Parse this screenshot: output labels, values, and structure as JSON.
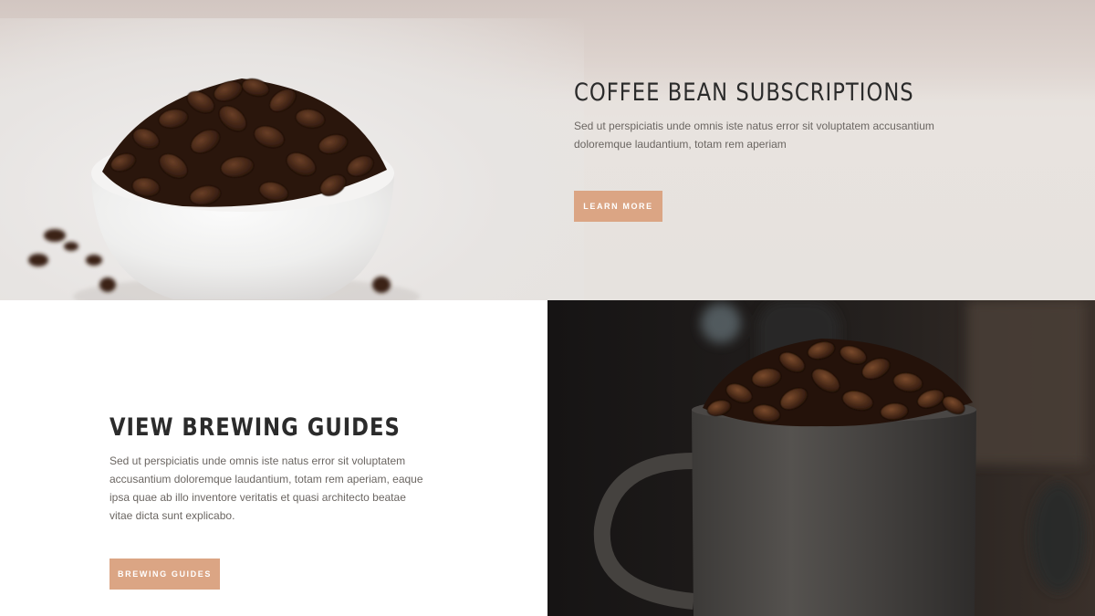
{
  "hero": {
    "title": "COFFEE BEAN SUBSCRIPTIONS",
    "description": "Sed ut perspiciatis unde omnis iste natus error sit voluptatem accusantium doloremque laudantium, totam rem aperiam",
    "button_label": "LEARN MORE"
  },
  "guides": {
    "title": "VIEW BREWING GUIDES",
    "description": "Sed ut perspiciatis unde omnis iste natus error sit voluptatem accusantium doloremque laudantium, totam rem aperiam, eaque ipsa quae ab illo inventore veritatis et quasi architecto beatae vitae dicta sunt explicabo.",
    "button_label": "BREWING GUIDES"
  },
  "colors": {
    "accent": "#dba584",
    "heading": "#2b2b2b",
    "body_text": "#6b6662"
  },
  "images": {
    "hero_photo": "coffee-beans-in-white-bowl",
    "guides_photo": "coffee-beans-in-dark-mug"
  }
}
